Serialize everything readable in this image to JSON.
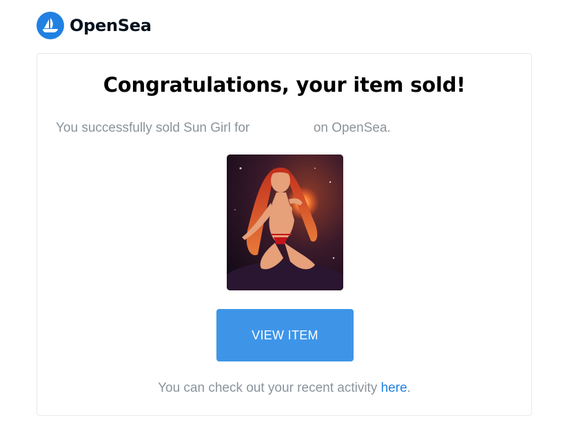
{
  "header": {
    "brand": "OpenSea",
    "logo_icon": "opensea-boat-icon",
    "brand_color": "#2081e2"
  },
  "card": {
    "title": "Congratulations, your item sold!",
    "message_prefix": "You successfully sold Sun Girl for",
    "message_suffix": "on OpenSea.",
    "item_image_alt": "Sun Girl",
    "view_button_label": "VIEW ITEM",
    "view_button_color": "#3e95e8",
    "footer_prefix": "You can check out your recent activity",
    "footer_link": "here",
    "footer_suffix": "."
  }
}
